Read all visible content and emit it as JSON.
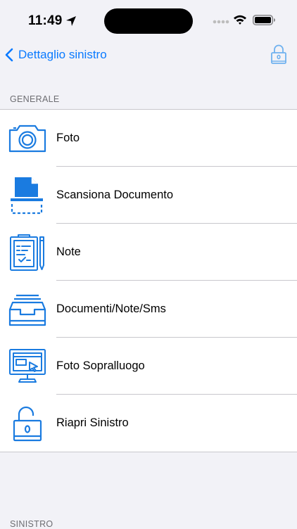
{
  "status_bar": {
    "time": "11:49"
  },
  "nav": {
    "back_label": "Dettaglio sinistro"
  },
  "sections": {
    "general_title": "GENERALE",
    "claim_title": "SINISTRO"
  },
  "menu": [
    {
      "label": "Foto",
      "icon": "camera-icon"
    },
    {
      "label": "Scansiona Documento",
      "icon": "document-scanner-icon"
    },
    {
      "label": "Note",
      "icon": "notes-clipboard-icon"
    },
    {
      "label": "Documenti/Note/Sms",
      "icon": "archive-tray-icon"
    },
    {
      "label": "Foto Sopralluogo",
      "icon": "inspection-monitor-icon"
    },
    {
      "label": "Riapri Sinistro",
      "icon": "unlock-icon"
    }
  ],
  "colors": {
    "accent": "#0a7aff",
    "icon_blue": "#1a7be0",
    "background": "#f2f2f7",
    "separator": "#c8c7cc",
    "section_text": "#6d6d72"
  }
}
